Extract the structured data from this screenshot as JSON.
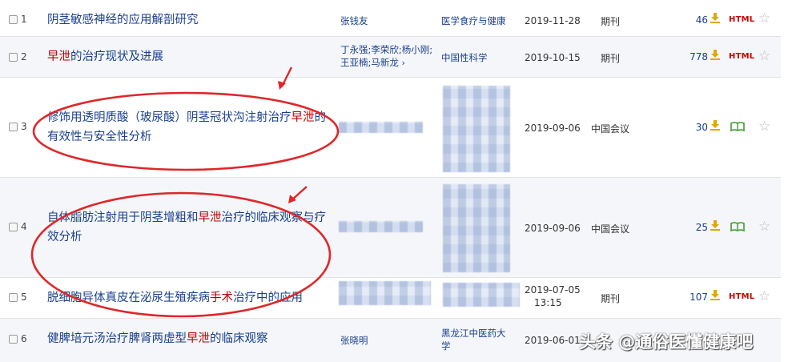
{
  "rows": [
    {
      "num": "1",
      "title_parts": [
        "阴茎敏感神经的应用解剖研究"
      ],
      "authors": [
        "张钱友"
      ],
      "source": [
        "医学食疗与健康"
      ],
      "date": [
        "2019-11-28"
      ],
      "type": "期刊",
      "cites": "46",
      "format": "HTML"
    },
    {
      "num": "2",
      "title_parts": [
        "早泄",
        "的治疗现状及进展"
      ],
      "authors": [
        "丁永强;李荣欣;杨小刚;",
        "王亚楠;马新龙"
      ],
      "source": [
        "中国性科学"
      ],
      "date": [
        "2019-10-15"
      ],
      "type": "期刊",
      "cites": "778",
      "format": "HTML"
    },
    {
      "num": "3",
      "title_parts": [
        "修饰用透明质酸（玻尿酸）阴茎冠状沟注射治疗",
        "早泄",
        "的有效性与安全性分析"
      ],
      "authors": [],
      "source": [],
      "date": [
        "2019-09-06"
      ],
      "type": "中国会议",
      "cites": "30",
      "format": ""
    },
    {
      "num": "4",
      "title_parts": [
        "自体脂肪注射用于阴茎增粗和",
        "早泄",
        "治疗的临床观察与疗效分析"
      ],
      "authors": [],
      "source": [],
      "date": [
        "2019-09-06"
      ],
      "type": "中国会议",
      "cites": "25",
      "format": ""
    },
    {
      "num": "5",
      "title_parts": [
        "脱细胞异体真皮在泌尿生殖疾病",
        "手术",
        "治疗中的应用"
      ],
      "authors": [],
      "source": [],
      "date": [
        "2019-07-05",
        "13:15"
      ],
      "type": "期刊",
      "cites": "107",
      "format": "HTML"
    },
    {
      "num": "6",
      "title_parts": [
        "健脾培元汤治疗脾肾两虚型",
        "早泄",
        "的临床观察"
      ],
      "authors": [
        "张晓明"
      ],
      "source": [
        "黑龙江中医药大",
        "学"
      ],
      "date": [
        "2019-06-01"
      ],
      "type": "",
      "cites": "",
      "format": ""
    }
  ],
  "more_authors_icon": "chevron-right-icon",
  "colors": {
    "link": "#1a3f8c",
    "highlight": "#b80000",
    "html_badge": "#c00000",
    "download": "#e0a800",
    "annotation": "#e0262a"
  },
  "watermark": "头条 @通俗医懂健康吧"
}
